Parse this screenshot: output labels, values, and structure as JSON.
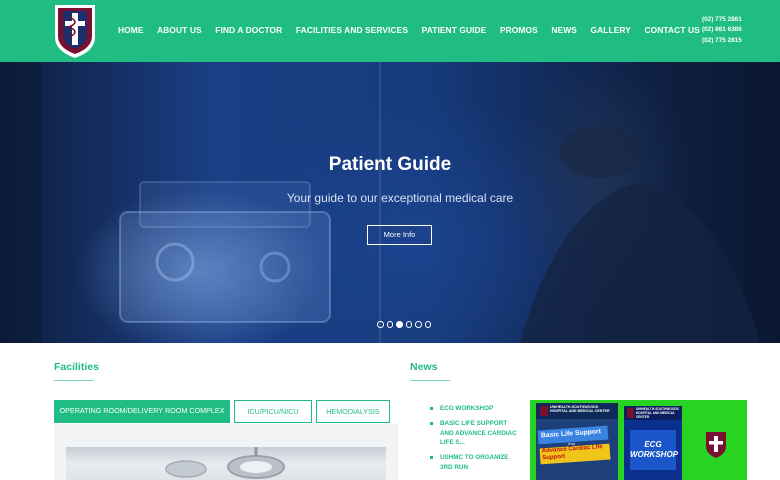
{
  "header": {
    "nav": [
      "HOME",
      "ABOUT US",
      "FIND A DOCTOR",
      "FACILITIES AND SERVICES",
      "PATIENT GUIDE",
      "PROMOS",
      "NEWS",
      "GALLERY",
      "CONTACT US"
    ],
    "phones": [
      "(02) 775 2861",
      "(02) 861 6386",
      "(02) 775 2815"
    ],
    "logo_icon": "hospital-shield-caduceus-logo"
  },
  "hero": {
    "title": "Patient Guide",
    "subtitle": "Your guide to our exceptional medical care",
    "button_label": "More Info",
    "slide_count": 6,
    "active_slide": 3
  },
  "facilities": {
    "title": "Facilities",
    "tabs": [
      "OPERATING ROOM/DELIVERY ROOM COMPLEX",
      "ICU/PICU/NICU",
      "HEMODIALYSIS"
    ],
    "active_tab": 0
  },
  "news": {
    "title": "News",
    "items": [
      "ECG WORKSHOP",
      "BASIC LIFE SUPPORT AND ADVANCE CARDIAC LIFE S...",
      "USHMC TO ORGANIZE 3RD RUN"
    ],
    "poster": {
      "left_header": "UNIHEALTH-SOUTHWOODS HOSPITAL AND MEDICAL CENTER",
      "left_title": "Basic Life Support",
      "left_subtitle": "Advance Cardiac Life Support",
      "conjunction": "And",
      "right_header": "UNIHEALTH-SOUTHWOODS HOSPITAL AND MEDICAL CENTER",
      "right_title": "ECG WORKSHOP"
    }
  },
  "colors": {
    "brand_green": "#1fbd83",
    "poster_green": "#28d422",
    "logo_maroon": "#7a1030",
    "logo_navy": "#1c2f6b"
  }
}
